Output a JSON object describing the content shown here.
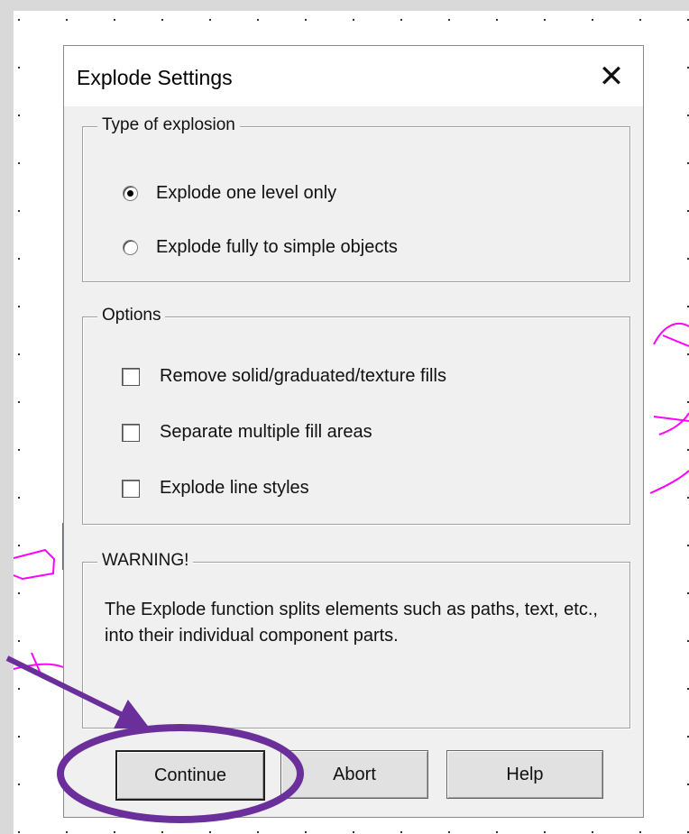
{
  "dialog": {
    "title": "Explode Settings",
    "close_symbol": "✕"
  },
  "explosion_type": {
    "legend": "Type of explosion",
    "options": [
      {
        "label": "Explode one level only",
        "checked": true
      },
      {
        "label": "Explode fully to simple objects",
        "checked": false
      }
    ]
  },
  "options_group": {
    "legend": "Options",
    "items": [
      {
        "label": "Remove solid/graduated/texture fills",
        "checked": false
      },
      {
        "label": "Separate multiple fill areas",
        "checked": false
      },
      {
        "label": "Explode line styles",
        "checked": false
      }
    ]
  },
  "warning": {
    "legend": "WARNING!",
    "text": "The Explode function splits elements such as paths, text, etc., into their individual component parts."
  },
  "buttons": {
    "continue": "Continue",
    "abort": "Abort",
    "help": "Help"
  },
  "colors": {
    "annotation": "#6b2f9c",
    "drawing": "#ff00ff"
  },
  "icons": {
    "close": "close-icon",
    "annotation_arrow": "arrow-icon",
    "annotation_ring": "ellipse-highlight"
  }
}
